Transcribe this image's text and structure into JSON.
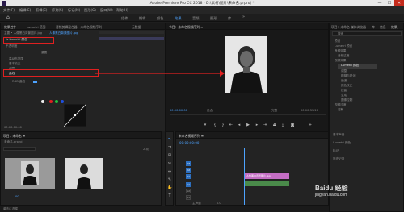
{
  "window": {
    "title": "Adobe Premiere Pro CC 2018 - D:\\素材\\图片\\未命名.prproj *",
    "minimize": "—",
    "maximize": "☐",
    "close": "✕"
  },
  "menu": {
    "items": [
      "文件(F)",
      "编辑(E)",
      "剪辑(C)",
      "序列(S)",
      "标记(M)",
      "图形(G)",
      "窗口(W)",
      "帮助(H)"
    ]
  },
  "workspaces": {
    "items": [
      "组件",
      "编辑",
      "颜色",
      "效果",
      "音频",
      "图形",
      "库"
    ],
    "active": "效果"
  },
  "left_panel": {
    "tabs": [
      "效果控件",
      "Lumetri 范围",
      "音频剪辑混合器：未命名视频序列",
      "元数据"
    ],
    "active_tab": "效果控件",
    "source_line": "主要 • 人像黑白背景图片.jpg",
    "sequence_line": "人像黑白背景图片.jpg",
    "effect_name": "fx Lumetri 颜色",
    "opacity_label": "不透明度",
    "reset_label": "重置",
    "rows": [
      "高动态范围",
      "基本校正",
      "创意",
      "曲线",
      "RGB 曲线",
      "色相饱和度曲线"
    ],
    "curves_label": "曲线",
    "rgb_curve_label": "RGB 曲线",
    "time_start": "00:00:00:00",
    "time_end": "00:00:05:00"
  },
  "program": {
    "tab": "节目：未命名视频序列 ≡",
    "timecode": "00:00:00:00",
    "fit": "适合",
    "quality": "完整",
    "duration": "00:00:31:20"
  },
  "project": {
    "tabs": [
      "项目：未命名",
      "媒体浏览器",
      "库",
      "信息",
      "效果"
    ],
    "search_placeholder": "搜索",
    "tree": [
      "预设",
      "Lumetri 预设",
      "音频效果",
      "音频过渡",
      "视频效果",
      "调整",
      "模糊与锐化",
      "通道",
      "颜色校正",
      "扭曲",
      "生成",
      "图像控制",
      "视频过渡",
      "溶解"
    ],
    "highlight": "Lumetri 颜色",
    "bottom": [
      "基本声音",
      "Lumetri 颜色",
      "标记",
      "历史记录"
    ]
  },
  "media": {
    "tab": "项目：未命名 ≡",
    "file": "未命名.prproj",
    "item_count": "2 项",
    "zoom": "00"
  },
  "timeline": {
    "tab": "未命名视频序列 ≡",
    "timecode": "00:00:00:00",
    "tracks_video": [
      "V3",
      "V2",
      "V1"
    ],
    "tracks_audio": [
      "A1",
      "A2",
      "A3"
    ],
    "clip_label": "人像黑白背景图片.jpg",
    "master": "主声道",
    "master_val": "0.0"
  },
  "status": {
    "text": "单击以选择"
  },
  "watermark": {
    "text": "jingyan.baidu.com",
    "brand": "Baidu 经验"
  }
}
